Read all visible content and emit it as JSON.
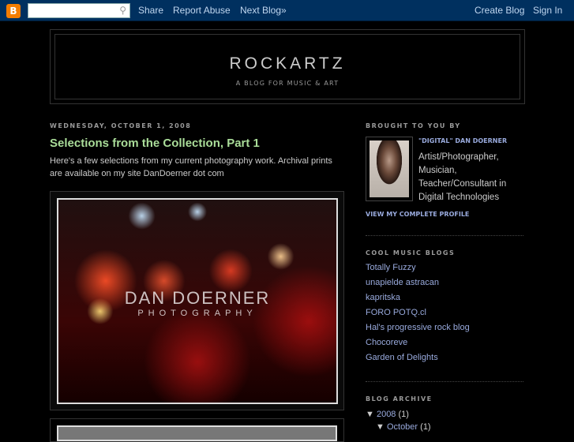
{
  "navbar": {
    "logo": "B",
    "search_placeholder": "",
    "share": "Share",
    "report_abuse": "Report Abuse",
    "next_blog": "Next Blog»",
    "create_blog": "Create Blog",
    "sign_in": "Sign In"
  },
  "header": {
    "title": "ROCKARTZ",
    "description": "A BLOG FOR MUSIC & ART"
  },
  "post": {
    "date": "WEDNESDAY, OCTOBER 1, 2008",
    "title": "Selections from the Collection, Part 1",
    "body": "Here's a few selections from my current photography work. Archival prints are available on my site DanDoerner dot com",
    "watermark_line1": "DAN DOERNER",
    "watermark_line2": "PHOTOGRAPHY"
  },
  "profile": {
    "heading": "BROUGHT TO YOU BY",
    "name": "\"DIGITAL\" DAN DOERNER",
    "description": "Artist/Photographer, Musician, Teacher/Consultant in Digital Technologies",
    "view_profile": "VIEW MY COMPLETE PROFILE"
  },
  "music_blogs": {
    "heading": "COOL MUSIC BLOGS",
    "items": [
      "Totally Fuzzy",
      "unapielde astracan",
      "kapritska",
      "FORO POTQ.cl",
      "Hal's progressive rock blog",
      "Chocoreve",
      "Garden of Delights"
    ]
  },
  "archive": {
    "heading": "BLOG ARCHIVE",
    "year": "2008",
    "year_count": "(1)",
    "month": "October",
    "month_count": "(1)"
  }
}
